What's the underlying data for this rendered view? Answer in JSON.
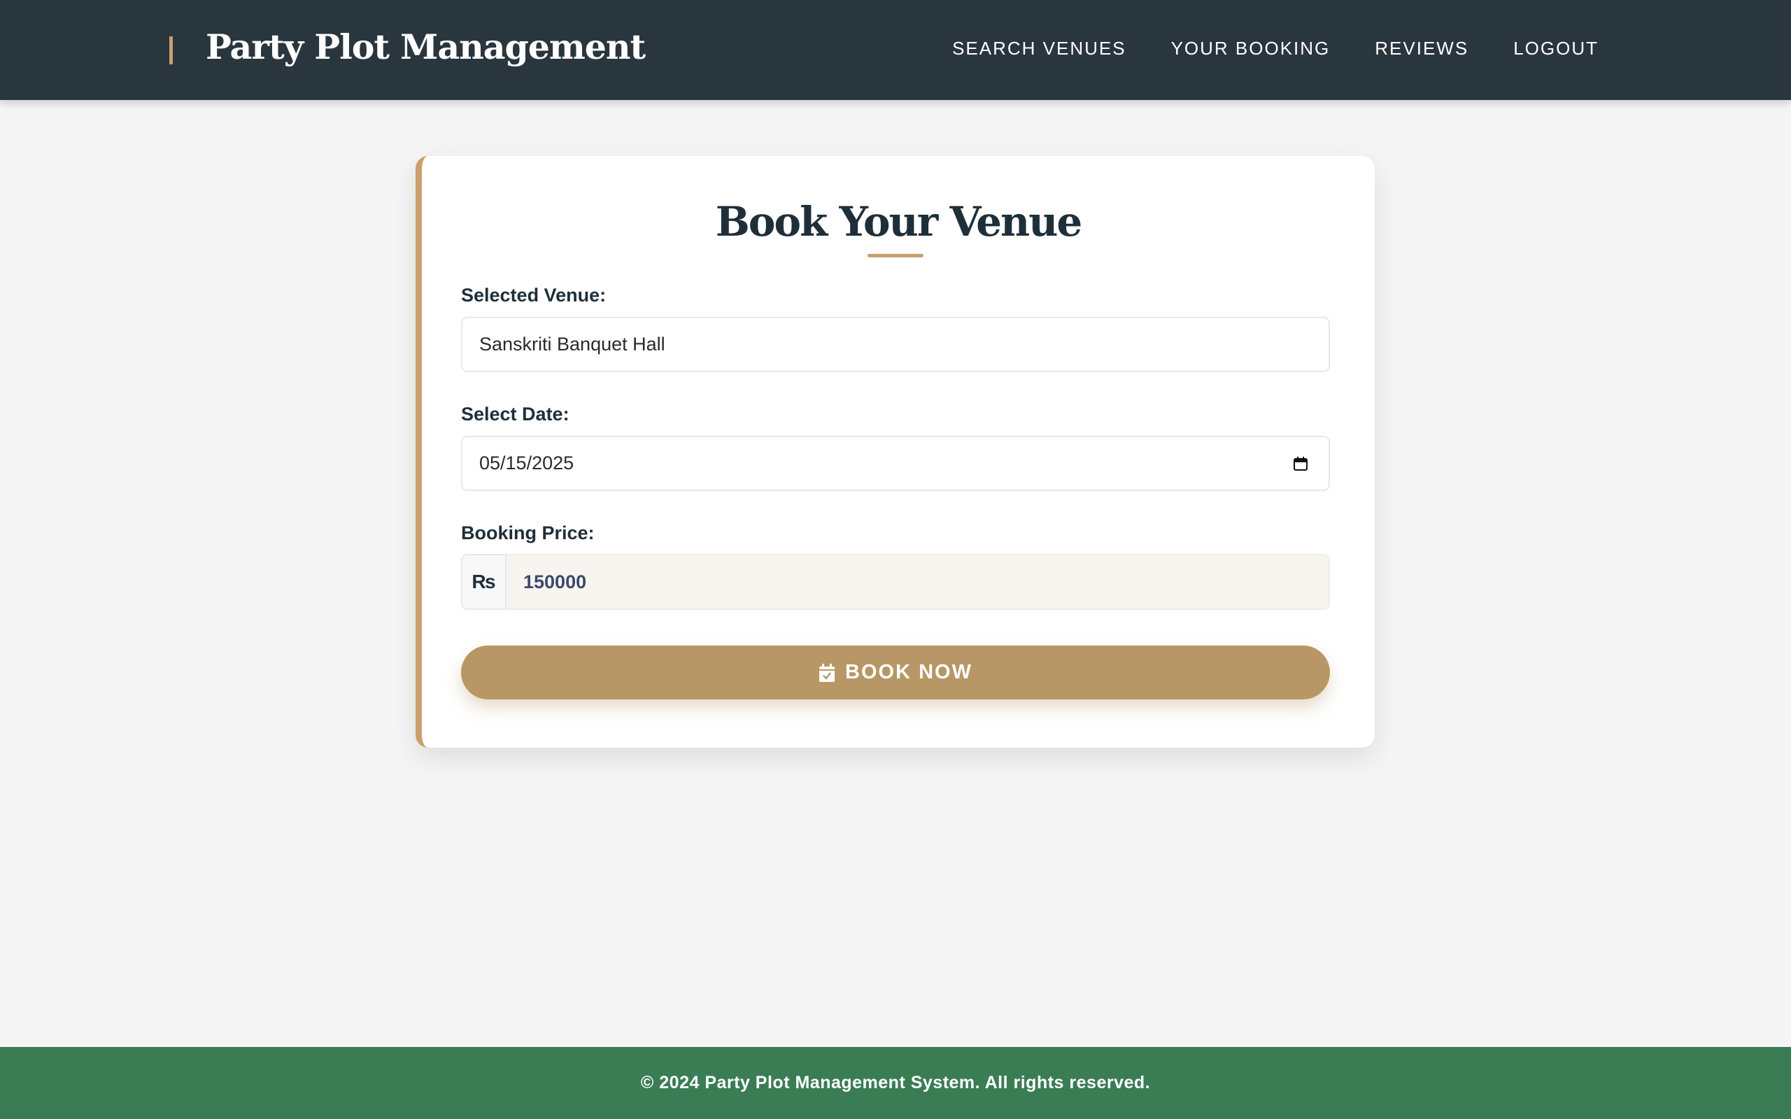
{
  "header": {
    "brand": "Party Plot Management",
    "nav": [
      {
        "label": "SEARCH VENUES"
      },
      {
        "label": "YOUR BOOKING"
      },
      {
        "label": "REVIEWS"
      },
      {
        "label": "LOGOUT"
      }
    ]
  },
  "form": {
    "title": "Book Your Venue",
    "venue_label": "Selected Venue:",
    "venue_value": "Sanskriti Banquet Hall",
    "date_label": "Select Date:",
    "date_value": "05/15/2025",
    "price_label": "Booking Price:",
    "currency_symbol": "₨",
    "price_value": "150000",
    "submit_label": "BOOK NOW"
  },
  "footer": {
    "text": "© 2024 Party Plot Management System. All rights reserved."
  },
  "colors": {
    "header_bg": "#2a363e",
    "accent": "#c9a06b",
    "button": "#b89766",
    "footer_bg": "#3a7d55"
  },
  "icons": {
    "calendar": "calendar-icon",
    "book_button": "calendar-check-icon"
  }
}
